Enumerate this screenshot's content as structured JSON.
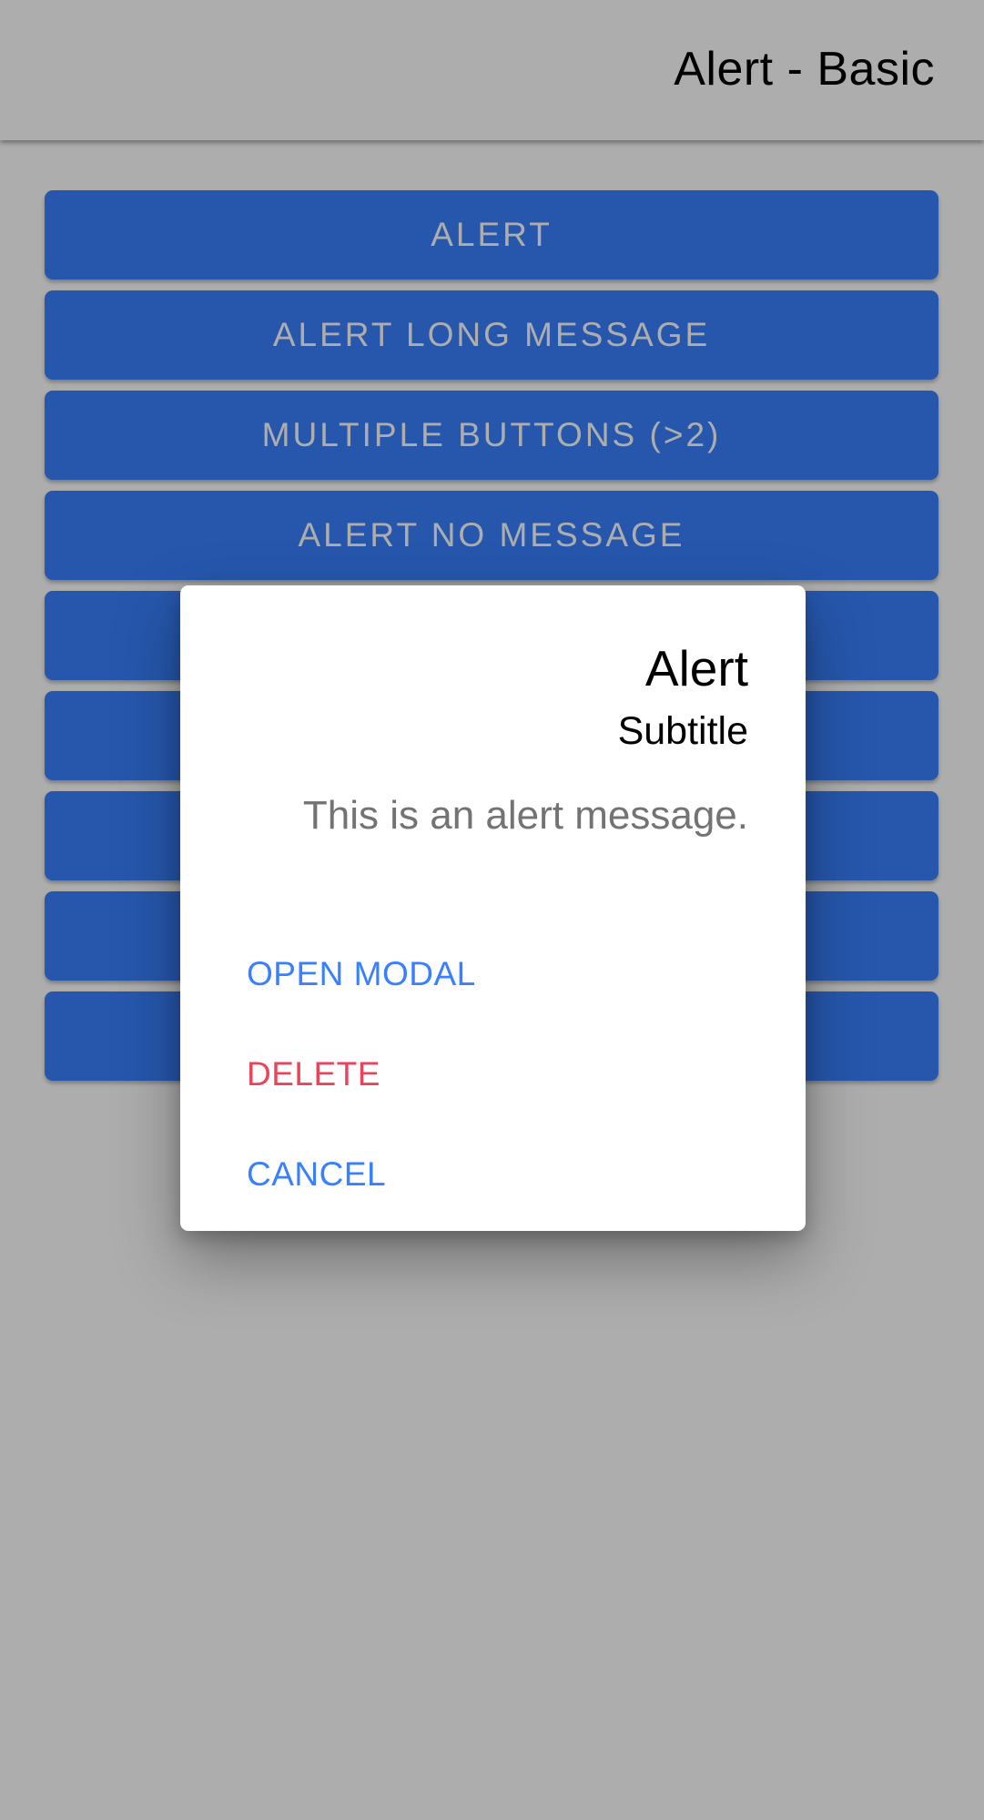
{
  "toolbar": {
    "title": "Alert - Basic"
  },
  "buttons": [
    "ALERT",
    "ALERT LONG MESSAGE",
    "MULTIPLE BUTTONS (>2)",
    "ALERT NO MESSAGE",
    "",
    "",
    "",
    "",
    ""
  ],
  "alert": {
    "title": "Alert",
    "subtitle": "Subtitle",
    "message": ".This is an alert message",
    "actions": [
      {
        "label": "OPEN MODAL",
        "color": "#3880ff"
      },
      {
        "label": "DELETE",
        "color": "#eb445a"
      },
      {
        "label": "CANCEL",
        "color": "#3880ff"
      }
    ]
  },
  "colors": {
    "primary": "#3880ff",
    "danger": "#eb445a",
    "backdrop": "rgba(0,0,0,0.32)"
  }
}
